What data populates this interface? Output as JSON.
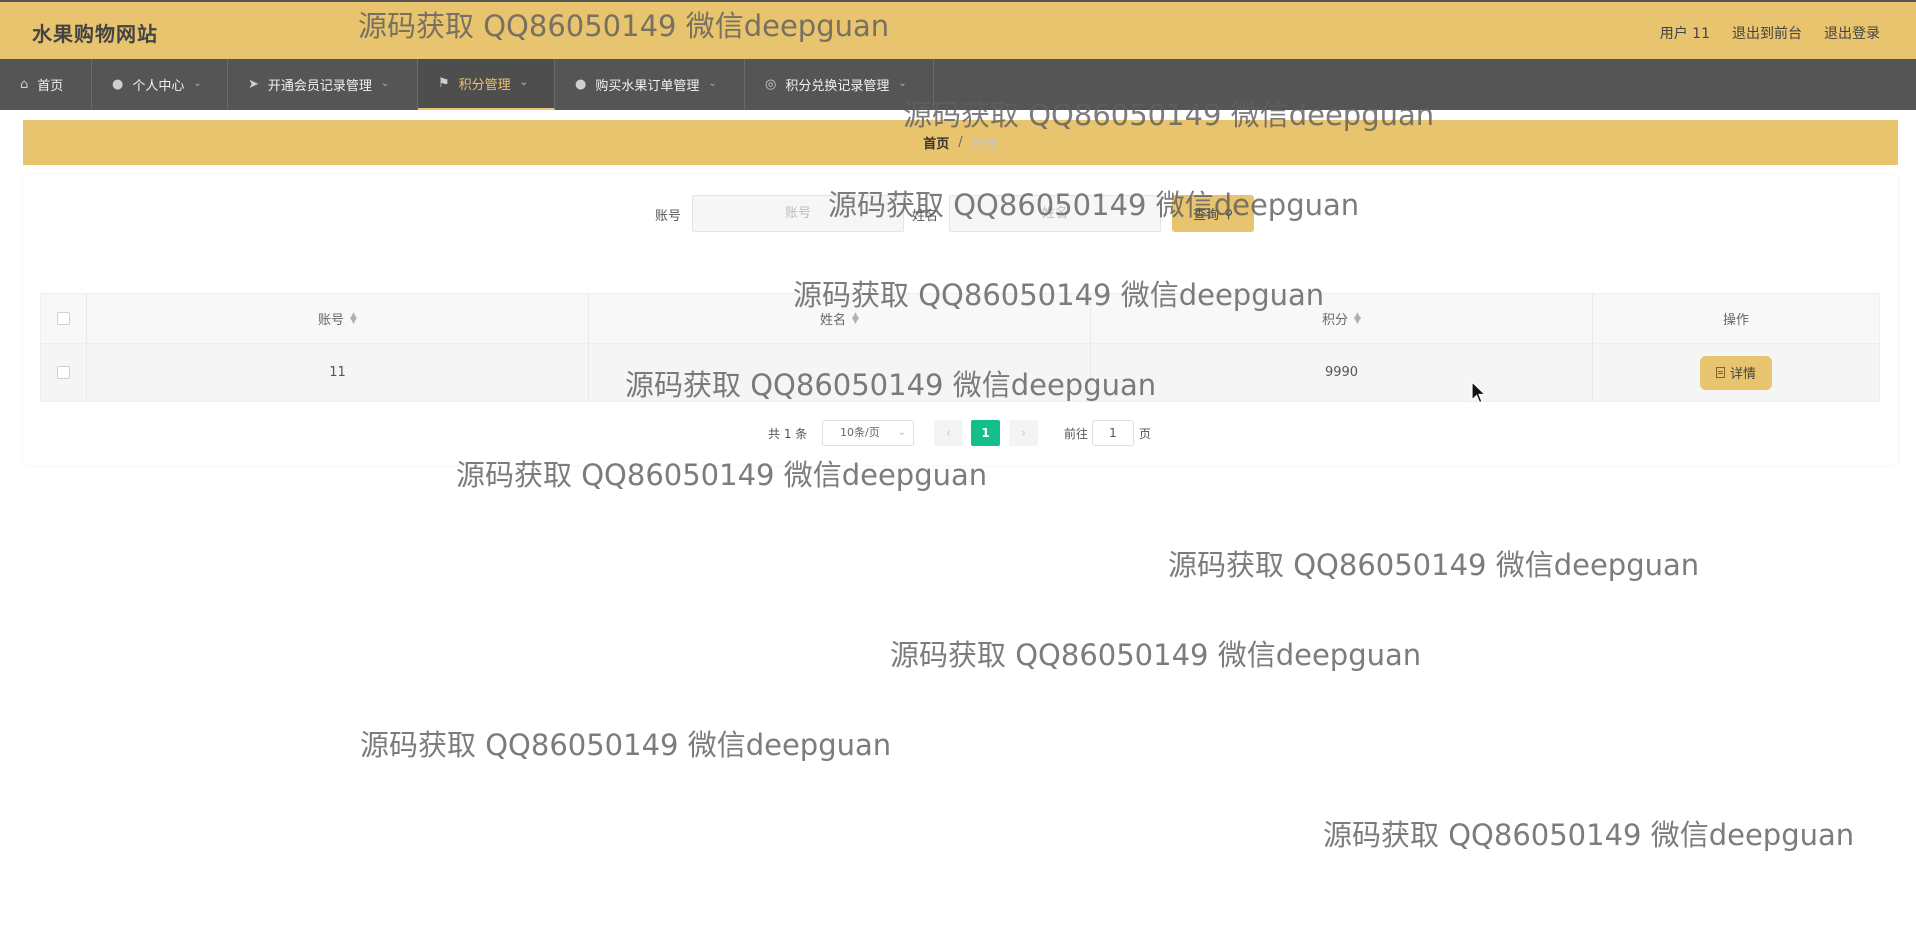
{
  "header": {
    "title": "水果购物网站",
    "links": [
      "用户 11",
      "退出到前台",
      "退出登录"
    ]
  },
  "nav": {
    "items": [
      {
        "label": "首页",
        "icon": "home-icon"
      },
      {
        "label": "个人中心",
        "icon": "user-icon"
      },
      {
        "label": "开通会员记录管理",
        "icon": "send-icon"
      },
      {
        "label": "积分管理",
        "icon": "flag-icon"
      },
      {
        "label": "购买水果订单管理",
        "icon": "user-icon"
      },
      {
        "label": "积分兑换记录管理",
        "icon": "compass-icon"
      }
    ],
    "active_index": 3
  },
  "breadcrumb": {
    "home": "首页",
    "separator": "/",
    "current": "积分"
  },
  "search": {
    "account_label": "账号",
    "account_placeholder": "账号",
    "name_label": "姓名",
    "name_placeholder": "姓名",
    "query_button": "查询"
  },
  "table": {
    "headers": {
      "account": "账号",
      "name": "姓名",
      "points": "积分",
      "action": "操作"
    },
    "rows": [
      {
        "account": "11",
        "name": "",
        "points": "9990",
        "action_label": "详情"
      }
    ]
  },
  "pagination": {
    "total": "共 1 条",
    "page_size": "10条/页",
    "current_page": "1",
    "goto_label": "前往",
    "goto_value": "1",
    "page_unit": "页"
  },
  "watermark": "源码获取 QQ86050149 微信deepguan",
  "colors": {
    "accent": "#e7c46d",
    "nav_bg": "#555555",
    "page_active": "#13c08c"
  }
}
